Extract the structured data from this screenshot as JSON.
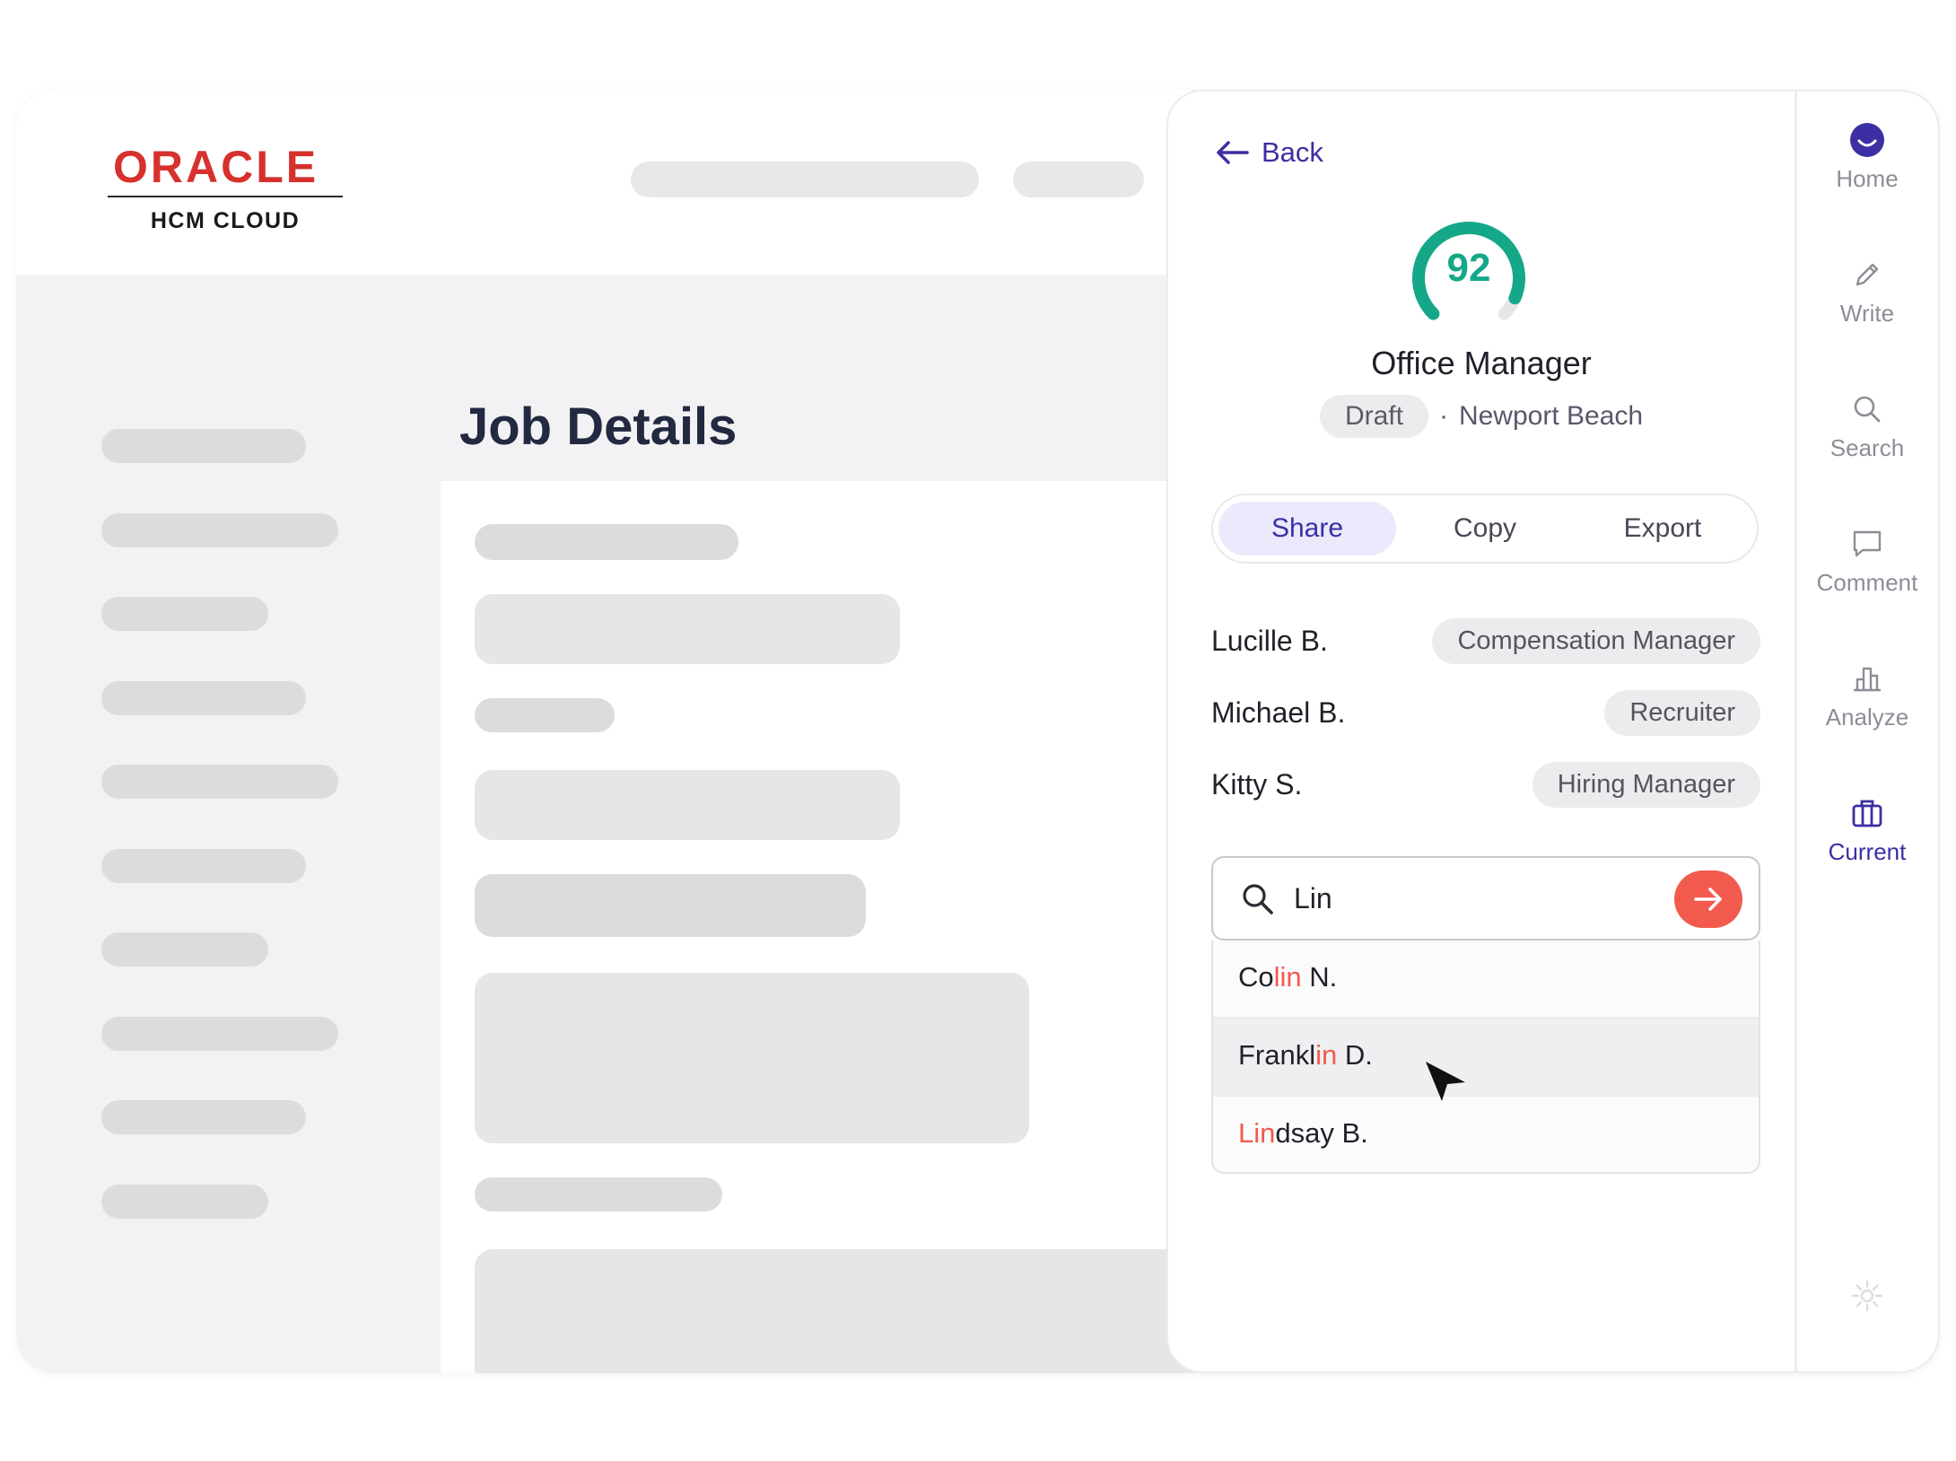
{
  "app": {
    "brand": "ORACLE",
    "subtitle": "HCM CLOUD"
  },
  "main": {
    "page_title": "Job Details"
  },
  "panel": {
    "back_label": "Back",
    "score": "92",
    "score_fraction": 0.92,
    "job_title": "Office Manager",
    "status": "Draft",
    "separator": "·",
    "location": "Newport Beach",
    "tabs": [
      {
        "label": "Share"
      },
      {
        "label": "Copy"
      },
      {
        "label": "Export"
      }
    ],
    "people": [
      {
        "name": "Lucille B.",
        "role": "Compensation Manager"
      },
      {
        "name": "Michael B.",
        "role": "Recruiter"
      },
      {
        "name": "Kitty S.",
        "role": "Hiring Manager"
      }
    ],
    "search": {
      "value": "Lin"
    },
    "results": [
      {
        "pre": "Co",
        "match": "lin",
        "post": " N."
      },
      {
        "pre": "Frankl",
        "match": "in",
        "post": " D."
      },
      {
        "pre": "",
        "match": "Lin",
        "post": "dsay B."
      }
    ]
  },
  "rail": {
    "items": [
      {
        "label": "Home",
        "icon": "home-icon"
      },
      {
        "label": "Write",
        "icon": "pencil-icon"
      },
      {
        "label": "Search",
        "icon": "search-icon"
      },
      {
        "label": "Comment",
        "icon": "comment-icon"
      },
      {
        "label": "Analyze",
        "icon": "bar-chart-icon"
      },
      {
        "label": "Current",
        "icon": "briefcase-icon"
      }
    ]
  },
  "colors": {
    "accent": "#3b2fa3",
    "score": "#14a889",
    "action": "#f25a4d",
    "brand": "#d6312d"
  }
}
